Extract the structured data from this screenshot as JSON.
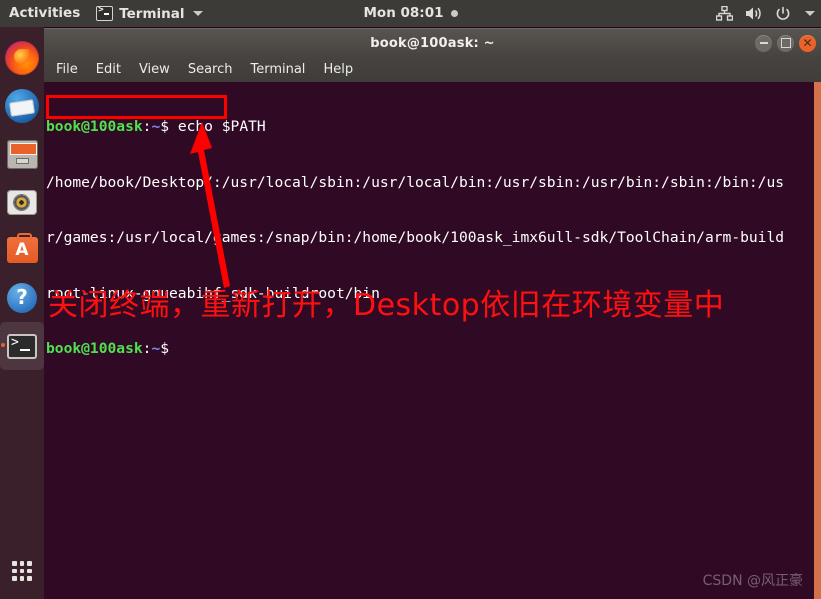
{
  "topbar": {
    "activities": "Activities",
    "app_menu": "Terminal",
    "app_icon": "terminal-icon",
    "clock": "Mon 08:01",
    "notification_dot": "notification-dot",
    "tray_icons": [
      "network-icon",
      "volume-icon",
      "power-icon",
      "chevron-down-icon"
    ]
  },
  "dock": {
    "items": [
      {
        "name": "firefox",
        "label": "Firefox Web Browser"
      },
      {
        "name": "thunderbird",
        "label": "Thunderbird Mail"
      },
      {
        "name": "files",
        "label": "Files"
      },
      {
        "name": "rhythmbox",
        "label": "Rhythmbox"
      },
      {
        "name": "software",
        "label": "Ubuntu Software"
      },
      {
        "name": "help",
        "label": "Help"
      },
      {
        "name": "terminal",
        "label": "Terminal",
        "active": true
      }
    ],
    "show_applications": "Show Applications"
  },
  "window": {
    "title": "book@100ask: ~",
    "buttons": {
      "minimize": "minimize-button",
      "maximize": "maximize-button",
      "close": "close-button"
    },
    "menu": [
      "File",
      "Edit",
      "View",
      "Search",
      "Terminal",
      "Help"
    ]
  },
  "terminal": {
    "prompt_user_host": "book@100ask",
    "prompt_colon": ":",
    "prompt_path": "~",
    "prompt_sign": "$ ",
    "command": "echo $PATH",
    "output_line_1": "/home/book/Desktop/:/usr/local/sbin:/usr/local/bin:/usr/sbin:/usr/bin:/sbin:/bin:/us",
    "output_line_2": "r/games:/usr/local/games:/snap/bin:/home/book/100ask_imx6ull-sdk/ToolChain/arm-build",
    "output_line_3": "root-linux-gnueabihf_sdk-buildroot/bin",
    "prompt_final_sign": "$"
  },
  "annotations": {
    "highlight_box_target": "/home/book/Desktop/:",
    "note_text": "关闭终端，重新打开，Desktop依旧在环境变量中",
    "note_color": "#ff1010",
    "arrow_color": "#ff0000",
    "watermark": "CSDN @风正豪"
  }
}
